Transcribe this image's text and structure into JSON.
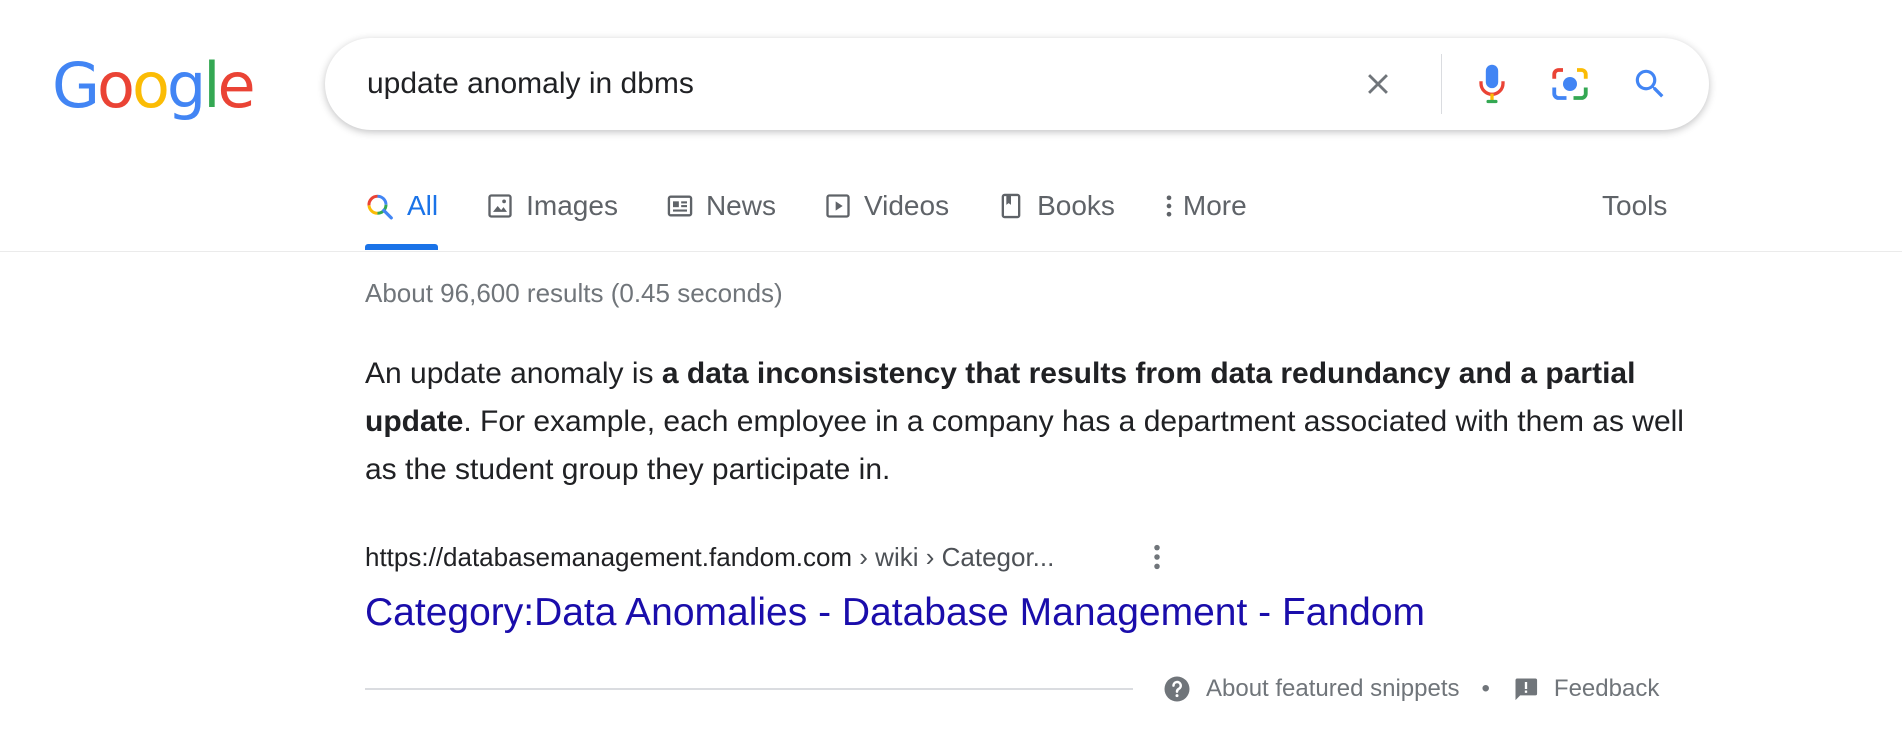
{
  "logo": {
    "letters": [
      "G",
      "o",
      "o",
      "g",
      "l",
      "e"
    ],
    "colors": [
      "#4285F4",
      "#EA4335",
      "#FBBC05",
      "#4285F4",
      "#34A853",
      "#EA4335"
    ]
  },
  "search": {
    "query": "update anomaly in dbms",
    "icons": [
      "clear-icon",
      "microphone-icon",
      "camera-lens-icon",
      "search-icon"
    ]
  },
  "tabs": [
    {
      "label": "All",
      "icon": "search-icon",
      "active": true
    },
    {
      "label": "Images",
      "icon": "image-icon",
      "active": false
    },
    {
      "label": "News",
      "icon": "news-icon",
      "active": false
    },
    {
      "label": "Videos",
      "icon": "video-play-icon",
      "active": false
    },
    {
      "label": "Books",
      "icon": "book-icon",
      "active": false
    },
    {
      "label": "More",
      "icon": "more-vertical-icon",
      "active": false
    }
  ],
  "tools_label": "Tools",
  "stats": "About 96,600 results (0.45 seconds)",
  "snippet": {
    "pre": "An update anomaly is ",
    "bold": "a data inconsistency that results from data redundancy and a partial update",
    "post": ". For example, each employee in a company has a department associated with them as well as the student group they participate in."
  },
  "result": {
    "domain": "https://databasemanagement.fandom.com",
    "path": " › wiki › Categor...",
    "title": "Category:Data Anomalies - Database Management - Fandom"
  },
  "footer": {
    "about_label": "About featured snippets",
    "separator": "•",
    "feedback_label": "Feedback"
  },
  "colors": {
    "accent": "#1a73e8",
    "link": "#1a0dab",
    "muted": "#70757a"
  }
}
